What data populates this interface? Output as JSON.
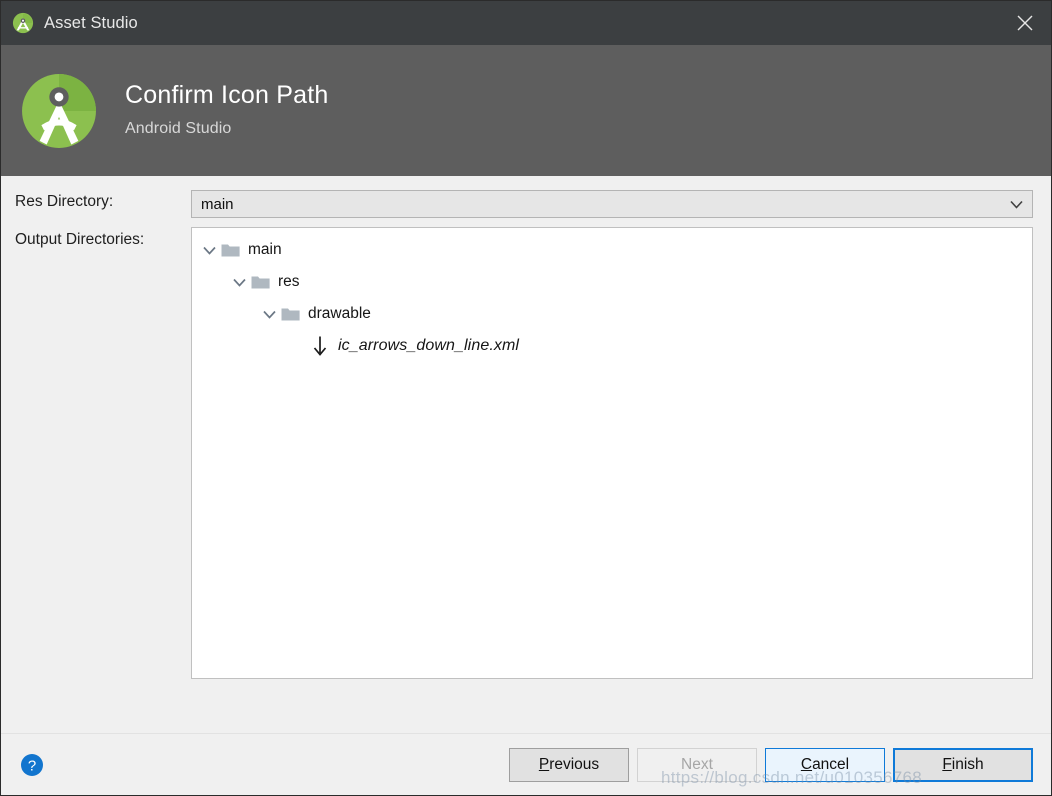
{
  "window": {
    "titlebar": {
      "app_icon": "android-studio-icon",
      "title": "Asset Studio",
      "close_label": "✕"
    },
    "header": {
      "logo": "android-studio-logo",
      "title": "Confirm Icon Path",
      "subtitle": "Android Studio"
    }
  },
  "form": {
    "res_directory": {
      "label": "Res Directory:",
      "value": "main",
      "arrow_icon": "chevron-down-icon"
    },
    "output_directories": {
      "label": "Output Directories:",
      "tree": [
        {
          "label": "main",
          "icon": "folder-icon",
          "twisty": "chevron-down-icon",
          "indent": 0,
          "type": "folder"
        },
        {
          "label": "res",
          "icon": "folder-icon",
          "twisty": "chevron-down-icon",
          "indent": 1,
          "type": "folder"
        },
        {
          "label": "drawable",
          "icon": "folder-icon",
          "twisty": "chevron-down-icon",
          "indent": 2,
          "type": "folder"
        },
        {
          "label": "ic_arrows_down_line.xml",
          "icon": "arrow-down-asset-icon",
          "twisty": "",
          "indent": 3,
          "type": "file"
        }
      ]
    }
  },
  "footer": {
    "help": {
      "icon": "help-icon",
      "label": "?"
    },
    "buttons": {
      "previous": {
        "prefix": "",
        "mnemonic": "P",
        "suffix": "revious",
        "enabled": true
      },
      "next": {
        "prefix": "",
        "mnemonic": "N",
        "suffix": "ext",
        "enabled": false
      },
      "cancel": {
        "prefix": "",
        "mnemonic": "C",
        "suffix": "ancel",
        "enabled": true
      },
      "finish": {
        "prefix": "",
        "mnemonic": "F",
        "suffix": "inish",
        "enabled": true
      }
    }
  },
  "watermark": {
    "text": "https://blog.csdn.net/u010356768"
  },
  "colors": {
    "titlebar_bg": "#3c3f41",
    "header_bg": "#5e5e5e",
    "body_bg": "#f0f0f0",
    "accent_blue": "#0f7ad8",
    "logo_green": "#7cb342",
    "folder_gray": "#afb8c0"
  }
}
